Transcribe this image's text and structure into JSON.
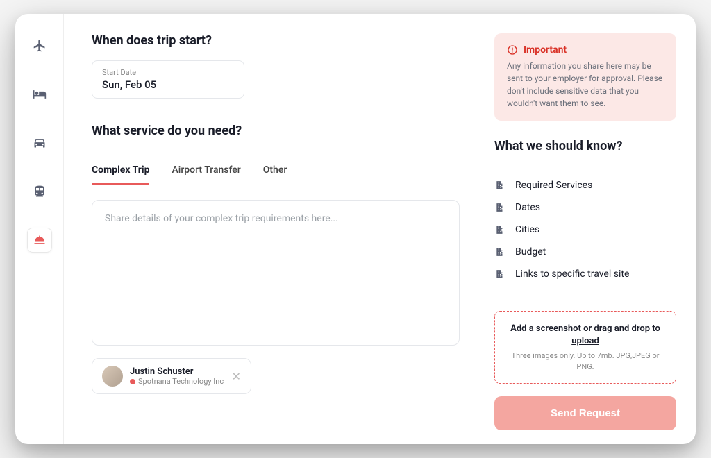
{
  "sidebar": {
    "items": [
      {
        "name": "flights",
        "icon": "airplane"
      },
      {
        "name": "hotels",
        "icon": "bed"
      },
      {
        "name": "cars",
        "icon": "car"
      },
      {
        "name": "rail",
        "icon": "train"
      },
      {
        "name": "concierge",
        "icon": "bell",
        "active": true
      }
    ]
  },
  "sections": {
    "trip_start_title": "When does trip start?",
    "service_title": "What service do you need?"
  },
  "start_date": {
    "label": "Start Date",
    "value": "Sun, Feb 05"
  },
  "tabs": [
    {
      "label": "Complex Trip",
      "active": true
    },
    {
      "label": "Airport Transfer"
    },
    {
      "label": "Other"
    }
  ],
  "details": {
    "placeholder": "Share details of your complex trip requirements here...",
    "value": ""
  },
  "user_chip": {
    "name": "Justin Schuster",
    "company": "Spotnana Technology Inc"
  },
  "alert": {
    "title": "Important",
    "body": "Any information you share here may be sent to your employer for approval. Please don't include sensitive data that you wouldn't want them to see."
  },
  "know": {
    "title": "What we should know?",
    "items": [
      "Required Services",
      "Dates",
      "Cities",
      "Budget",
      "Links to specific travel site"
    ]
  },
  "upload": {
    "title": "Add a screenshot or drag and drop to upload",
    "sub": "Three images only. Up to 7mb. JPG,JPEG or PNG."
  },
  "actions": {
    "send_label": "Send Request"
  },
  "colors": {
    "accent": "#e85a5a",
    "alert_bg": "#fce8e6",
    "alert_text": "#d93025"
  }
}
